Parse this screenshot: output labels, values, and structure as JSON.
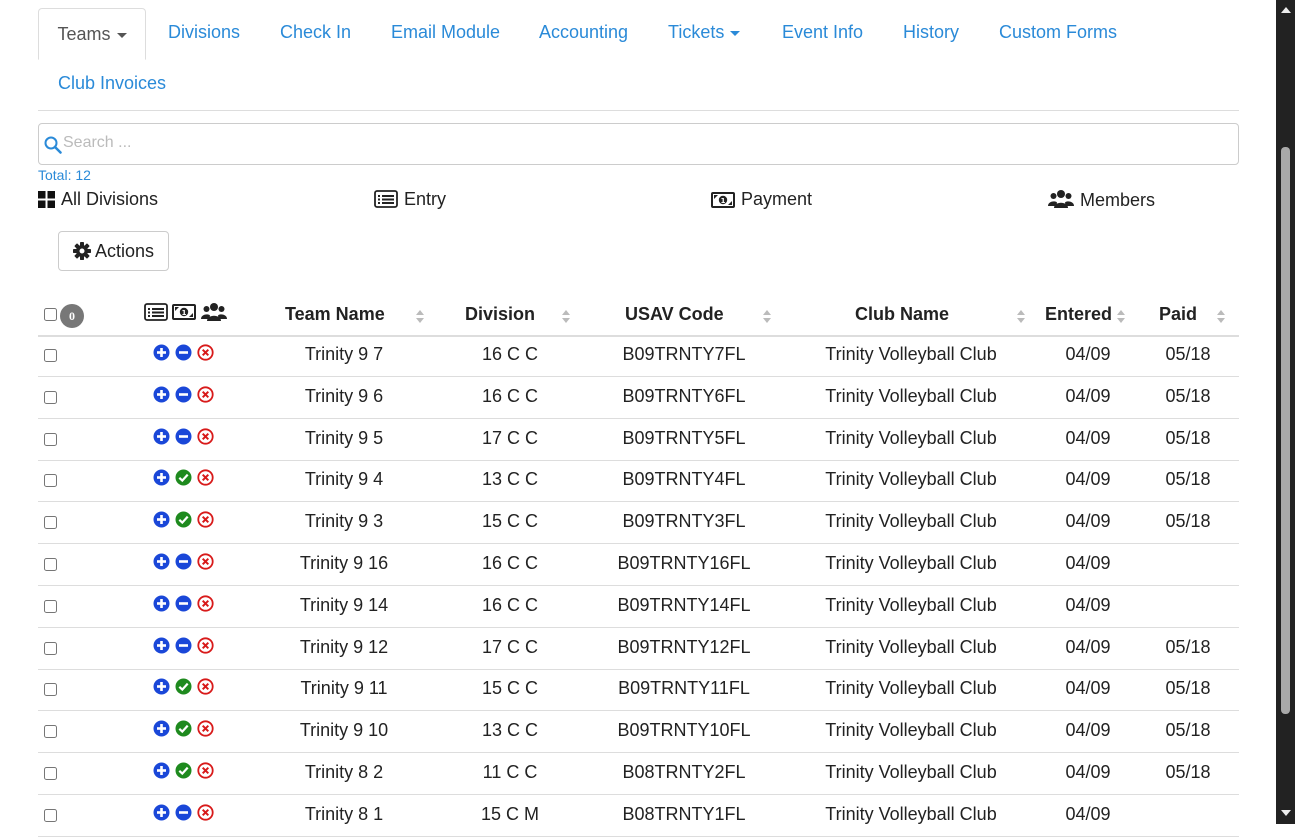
{
  "tabs": [
    {
      "label": "Teams",
      "active": true,
      "dropdown": true
    },
    {
      "label": "Divisions"
    },
    {
      "label": "Check In"
    },
    {
      "label": "Email Module"
    },
    {
      "label": "Accounting"
    },
    {
      "label": "Tickets",
      "dropdown": true
    },
    {
      "label": "Event Info"
    },
    {
      "label": "History"
    },
    {
      "label": "Custom Forms"
    },
    {
      "label": "Club Invoices"
    }
  ],
  "search": {
    "placeholder": "Search ...",
    "value": ""
  },
  "total": "Total: 12",
  "filters": [
    {
      "label": "All Divisions",
      "icon": "grid-icon"
    },
    {
      "label": "Entry",
      "icon": "list-alt-icon"
    },
    {
      "label": "Payment",
      "icon": "money-icon"
    },
    {
      "label": "Members",
      "icon": "users-icon"
    }
  ],
  "actions": {
    "label": "Actions"
  },
  "table": {
    "selected_count": "0",
    "columns": [
      "Team Name",
      "Division",
      "USAV Code",
      "Club Name",
      "Entered",
      "Paid"
    ],
    "rows": [
      {
        "team": "Trinity 9 7",
        "division": "16 C C",
        "code": "B09TRNTY7FL",
        "club": "Trinity Volleyball Club",
        "entered": "04/09",
        "paid": "05/18",
        "payment_status": "pending"
      },
      {
        "team": "Trinity 9 6",
        "division": "16 C C",
        "code": "B09TRNTY6FL",
        "club": "Trinity Volleyball Club",
        "entered": "04/09",
        "paid": "05/18",
        "payment_status": "pending"
      },
      {
        "team": "Trinity 9 5",
        "division": "17 C C",
        "code": "B09TRNTY5FL",
        "club": "Trinity Volleyball Club",
        "entered": "04/09",
        "paid": "05/18",
        "payment_status": "pending"
      },
      {
        "team": "Trinity 9 4",
        "division": "13 C C",
        "code": "B09TRNTY4FL",
        "club": "Trinity Volleyball Club",
        "entered": "04/09",
        "paid": "05/18",
        "payment_status": "paid"
      },
      {
        "team": "Trinity 9 3",
        "division": "15 C C",
        "code": "B09TRNTY3FL",
        "club": "Trinity Volleyball Club",
        "entered": "04/09",
        "paid": "05/18",
        "payment_status": "paid"
      },
      {
        "team": "Trinity 9 16",
        "division": "16 C C",
        "code": "B09TRNTY16FL",
        "club": "Trinity Volleyball Club",
        "entered": "04/09",
        "paid": "",
        "payment_status": "pending"
      },
      {
        "team": "Trinity 9 14",
        "division": "16 C C",
        "code": "B09TRNTY14FL",
        "club": "Trinity Volleyball Club",
        "entered": "04/09",
        "paid": "",
        "payment_status": "pending"
      },
      {
        "team": "Trinity 9 12",
        "division": "17 C C",
        "code": "B09TRNTY12FL",
        "club": "Trinity Volleyball Club",
        "entered": "04/09",
        "paid": "05/18",
        "payment_status": "pending"
      },
      {
        "team": "Trinity 9 11",
        "division": "15 C C",
        "code": "B09TRNTY11FL",
        "club": "Trinity Volleyball Club",
        "entered": "04/09",
        "paid": "05/18",
        "payment_status": "paid"
      },
      {
        "team": "Trinity 9 10",
        "division": "13 C C",
        "code": "B09TRNTY10FL",
        "club": "Trinity Volleyball Club",
        "entered": "04/09",
        "paid": "05/18",
        "payment_status": "paid"
      },
      {
        "team": "Trinity 8 2",
        "division": "11 C C",
        "code": "B08TRNTY2FL",
        "club": "Trinity Volleyball Club",
        "entered": "04/09",
        "paid": "05/18",
        "payment_status": "paid"
      },
      {
        "team": "Trinity 8 1",
        "division": "15 C M",
        "code": "B08TRNTY1FL",
        "club": "Trinity Volleyball Club",
        "entered": "04/09",
        "paid": "",
        "payment_status": "pending"
      }
    ]
  },
  "colors": {
    "link": "#2a8ad8",
    "add": "#1a47d8",
    "paid": "#1e8a1e",
    "remove": "#d81a1a",
    "badge": "#777777"
  }
}
